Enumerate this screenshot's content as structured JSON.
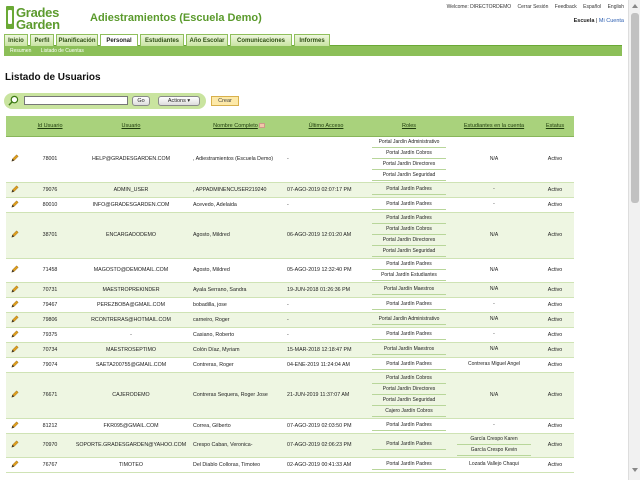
{
  "app": {
    "logo_line1": "Grades",
    "logo_line2": "Garden",
    "title": "Adiestramientos (Escuela Demo)"
  },
  "toplinks": [
    "Welcome: DIRECTORDEMO",
    "Cerrar Sesión",
    "Feedback",
    "Español",
    "English"
  ],
  "userlinks": {
    "school": "Escuela",
    "sep": " | ",
    "account": "Mi Cuenta"
  },
  "tabs": [
    "Inicio",
    "Perfil",
    "Planificación",
    "Personal",
    "Estudiantes",
    "Año Escolar",
    "Comunicaciones",
    "Informes"
  ],
  "subnav": [
    "Resumen",
    "Listado de Cuentas"
  ],
  "page_title": "Listado de Usuarios",
  "search": {
    "value": "",
    "go": "Go",
    "actions": "Actions ▾",
    "create": "Crear"
  },
  "columns": [
    "Id Usuario",
    "Usuario",
    "Nombre Completo",
    "Último Acceso",
    "Roles",
    "Estudiantes en la cuenta",
    "Estatus"
  ],
  "rows": [
    {
      "id": "78001",
      "user": "HELP@GRADESGARDEN.COM",
      "name": ", Adiestramientos (Escuela Demo)",
      "last": "-",
      "roles": [
        "Portal Jardín Administrativo",
        "Portal Jardín Cobros",
        "Portal Jardín Directores",
        "Portal Jardín Seguridad"
      ],
      "students": [
        "N/A"
      ],
      "status": "Activo"
    },
    {
      "id": "79076",
      "user": "ADMIN_USER",
      "name": ", APPADMINENCUSER219240",
      "last": "07-AGO-2019 02:07:17 PM",
      "roles": [
        "Portal Jardín Padres"
      ],
      "students": [
        "-"
      ],
      "status": "Activo"
    },
    {
      "id": "80010",
      "user": "INFO@GRADESGARDEN.COM",
      "name": "Acevedo, Adelaida",
      "last": "-",
      "roles": [
        "Portal Jardín Padres"
      ],
      "students": [
        "-"
      ],
      "status": "Activo"
    },
    {
      "id": "38701",
      "user": "ENCARGADODEMO",
      "name": "Agosto, Mildred",
      "last": "06-AGO-2019 12:01:20 AM",
      "roles": [
        "Portal Jardín Padres",
        "Portal Jardín Cobros",
        "Portal Jardín Directores",
        "Portal Jardín Seguridad"
      ],
      "students": [
        "N/A"
      ],
      "status": "Activo"
    },
    {
      "id": "71458",
      "user": "MAGOSTO@DEMOMAIL.COM",
      "name": "Agosto, Mildred",
      "last": "05-AGO-2019 12:32:40 PM",
      "roles": [
        "Portal Jardín Padres",
        "Portal Jardín Estudiantes"
      ],
      "students": [
        "N/A"
      ],
      "status": "Activo"
    },
    {
      "id": "70731",
      "user": "MAESTROPREKINDER",
      "name": "Ayala Serrano, Sandra",
      "last": "19-JUN-2018 01:26:36 PM",
      "roles": [
        "Portal Jardín Maestros"
      ],
      "students": [
        "N/A"
      ],
      "status": "Activo"
    },
    {
      "id": "79467",
      "user": "PEREZBOBA@GMAIL.COM",
      "name": "bobadilla, jose",
      "last": "-",
      "roles": [
        "Portal Jardín Padres"
      ],
      "students": [
        "-"
      ],
      "status": "Activo"
    },
    {
      "id": "79806",
      "user": "RCONTRERAS@HOTMAIL.COM",
      "name": "carneiro, Roger",
      "last": "-",
      "roles": [
        "Portal Jardín Administrativo"
      ],
      "students": [
        "N/A"
      ],
      "status": "Activo"
    },
    {
      "id": "79375",
      "user": "-",
      "name": "Casiano, Roberto",
      "last": "-",
      "roles": [
        "Portal Jardín Padres"
      ],
      "students": [
        "-"
      ],
      "status": "Activo"
    },
    {
      "id": "70734",
      "user": "MAESTROSEPTIMO",
      "name": "Colón Díaz, Myriam",
      "last": "15-MAR-2018 12:18:47 PM",
      "roles": [
        "Portal Jardín Maestros"
      ],
      "students": [
        "N/A"
      ],
      "status": "Activo"
    },
    {
      "id": "79074",
      "user": "SAETA200755@GMAIL.COM",
      "name": "Contreras, Roger",
      "last": "04-ENE-2019 11:24:04 AM",
      "roles": [
        "Portal Jardín Padres"
      ],
      "students": [
        "Contreras Miguel Angel"
      ],
      "status": "Activo"
    },
    {
      "id": "76671",
      "user": "CAJERODEMO",
      "name": "Contreras Sequera, Roger Jose",
      "last": "21-JUN-2019 11:37:07 AM",
      "roles": [
        "Portal Jardín Cobros",
        "Portal Jardín Directores",
        "Portal Jardín Seguridad",
        "Cajero Jardín Cobros"
      ],
      "students": [
        "N/A"
      ],
      "status": "Activo"
    },
    {
      "id": "81212",
      "user": "FKR095@GMAIL.COM",
      "name": "Correa, Gilberto",
      "last": "07-AGO-2019 02:03:50 PM",
      "roles": [
        "Portal Jardín Padres"
      ],
      "students": [
        "-"
      ],
      "status": "Activo"
    },
    {
      "id": "70970",
      "user": "SOPORTE.GRADESGARDEN@YAHOO.COM",
      "name": "Crespo Caban, Veronica-",
      "last": "07-AGO-2019 02:06:23 PM",
      "roles": [
        "Portal Jardín Padres"
      ],
      "students": [
        "García Crespo Karen",
        "García Crespo Kevin"
      ],
      "status": "Activo"
    },
    {
      "id": "76767",
      "user": "TIMOTEO",
      "name": "Del Diablo Colloras, Timoteo",
      "last": "02-AGO-2019 00:41:33 AM",
      "roles": [
        "Portal Jardín Padres"
      ],
      "students": [
        "Lozada Vallejo Chaqui"
      ],
      "status": "Activo"
    }
  ]
}
